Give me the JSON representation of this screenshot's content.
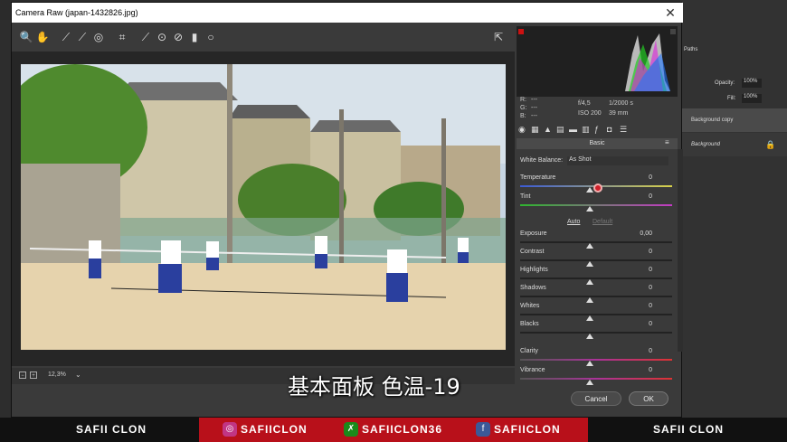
{
  "window": {
    "title": "Camera Raw (japan-1432826.jpg)"
  },
  "ps_panel": {
    "tab_paths": "Paths",
    "opacity_label": "Opacity:",
    "opacity_value": "100%",
    "fill_label": "Fill:",
    "fill_value": "100%",
    "layers": [
      "Background copy",
      "Background"
    ]
  },
  "statusbar": {
    "zoom": "12,3%"
  },
  "readout": {
    "r_label": "R:",
    "g_label": "G:",
    "b_label": "B:",
    "r": "---",
    "g": "---",
    "b": "---",
    "aperture": "f/4,5",
    "shutter": "1/2000 s",
    "iso": "ISO 200",
    "focal": "39 mm"
  },
  "panel": {
    "title": "Basic",
    "white_balance_label": "White Balance:",
    "white_balance_value": "As Shot",
    "auto": "Auto",
    "default": "Default",
    "sliders": [
      {
        "label": "Temperature",
        "value": "0",
        "position": 0.46
      },
      {
        "label": "Tint",
        "value": "0",
        "position": 0.46
      },
      {
        "label": "Exposure",
        "value": "0,00",
        "position": 0.46
      },
      {
        "label": "Contrast",
        "value": "0",
        "position": 0.46
      },
      {
        "label": "Highlights",
        "value": "0",
        "position": 0.46
      },
      {
        "label": "Shadows",
        "value": "0",
        "position": 0.46
      },
      {
        "label": "Whites",
        "value": "0",
        "position": 0.46
      },
      {
        "label": "Blacks",
        "value": "0",
        "position": 0.46
      },
      {
        "label": "Clarity",
        "value": "0",
        "position": 0.46
      },
      {
        "label": "Vibrance",
        "value": "0",
        "position": 0.46
      }
    ]
  },
  "buttons": {
    "cancel": "Cancel",
    "ok": "OK"
  },
  "subtitle": "基本面板   色温-19",
  "banner": {
    "left": "SAFII CLON",
    "instagram": "SAFIICLON",
    "x": "SAFIICLON36",
    "facebook": "SAFIICLON",
    "right": "SAFII CLON"
  },
  "colors": {
    "accent": "#b8101a",
    "panel_bg": "#3a3a3a"
  }
}
